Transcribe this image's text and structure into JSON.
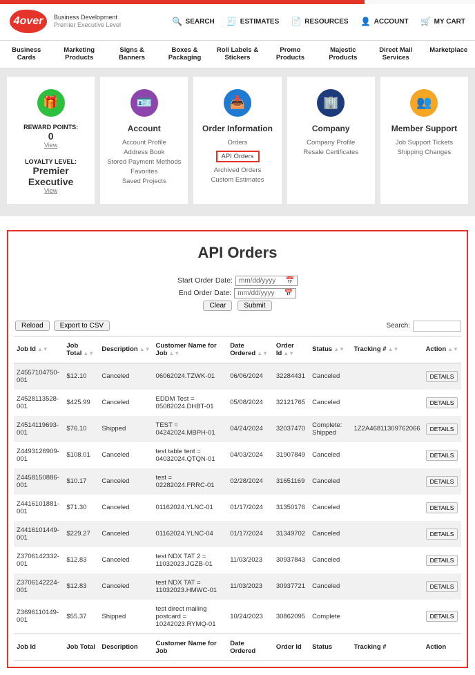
{
  "branding": {
    "logo_text": "4over",
    "sub1": "Business Development",
    "sub2": "Premier Executive Level"
  },
  "header_links": {
    "search": "SEARCH",
    "estimates": "ESTIMATES",
    "resources": "RESOURCES",
    "account": "ACCOUNT",
    "cart": "MY CART"
  },
  "nav": [
    "Business Cards",
    "Marketing Products",
    "Signs & Banners",
    "Boxes & Packaging",
    "Roll Labels & Stickers",
    "Promo Products",
    "Majestic Products",
    "Direct Mail Services",
    "Marketplace"
  ],
  "rewards": {
    "points_label": "REWARD POINTS:",
    "points_value": "0",
    "view": "View",
    "loyalty_label": "LOYALTY LEVEL:",
    "loyalty1": "Premier",
    "loyalty2": "Executive"
  },
  "cards": {
    "account": {
      "title": "Account",
      "links": [
        "Account Profile",
        "Address Book",
        "Stored Payment Methods",
        "Favorites",
        "Saved Projects"
      ]
    },
    "order_info": {
      "title": "Order Information",
      "links": [
        "Orders",
        "API Orders",
        "Archived Orders",
        "Custom Estimates"
      ],
      "selected_index": 1
    },
    "company": {
      "title": "Company",
      "links": [
        "Company Profile",
        "Resale Certificates"
      ]
    },
    "support": {
      "title": "Member Support",
      "links": [
        "Job Support Tickets",
        "Shipping Changes"
      ]
    }
  },
  "api_panel": {
    "title": "API Orders",
    "start_label": "Start Order Date:",
    "end_label": "End Order Date:",
    "date_placeholder": "mm/dd/yyyy",
    "clear": "Clear",
    "submit": "Submit",
    "reload": "Reload",
    "export": "Export to CSV",
    "search_label": "Search:"
  },
  "columns": [
    "Job Id",
    "Job Total",
    "Description",
    "Customer Name for Job",
    "Date Ordered",
    "Order Id",
    "Status",
    "Tracking #",
    "Action"
  ],
  "rows": [
    {
      "job": "Z4557104750-001",
      "total": "$12.10",
      "desc": "Canceled",
      "cust": "06062024.TZWK-01",
      "date": "06/06/2024",
      "order": "32284431",
      "status": "Canceled",
      "track": ""
    },
    {
      "job": "Z4528113528-001",
      "total": "$425.99",
      "desc": "Canceled",
      "cust": "EDDM Test = 05082024.DHBT-01",
      "date": "05/08/2024",
      "order": "32121765",
      "status": "Canceled",
      "track": ""
    },
    {
      "job": "Z4514119693-001",
      "total": "$76.10",
      "desc": "Shipped",
      "cust": "TEST = 04242024.MBPH-01",
      "date": "04/24/2024",
      "order": "32037470",
      "status": "Complete: Shipped",
      "track": "1Z2A46811309762066"
    },
    {
      "job": "Z4493126909-001",
      "total": "$108.01",
      "desc": "Canceled",
      "cust": "test table tent = 04032024.QTQN-01",
      "date": "04/03/2024",
      "order": "31907849",
      "status": "Canceled",
      "track": ""
    },
    {
      "job": "Z4458150886-001",
      "total": "$10.17",
      "desc": "Canceled",
      "cust": "test = 02282024.FRRC-01",
      "date": "02/28/2024",
      "order": "31651169",
      "status": "Canceled",
      "track": ""
    },
    {
      "job": "Z4416101881-001",
      "total": "$71.30",
      "desc": "Canceled",
      "cust": "01162024.YLNC-01",
      "date": "01/17/2024",
      "order": "31350176",
      "status": "Canceled",
      "track": ""
    },
    {
      "job": "Z4416101449-001",
      "total": "$229.27",
      "desc": "Canceled",
      "cust": "01162024.YLNC-04",
      "date": "01/17/2024",
      "order": "31349702",
      "status": "Canceled",
      "track": ""
    },
    {
      "job": "Z3706142332-001",
      "total": "$12.83",
      "desc": "Canceled",
      "cust": "test NDX TAT 2 = 11032023.JGZB-01",
      "date": "11/03/2023",
      "order": "30937843",
      "status": "Canceled",
      "track": ""
    },
    {
      "job": "Z3706142224-001",
      "total": "$12.83",
      "desc": "Canceled",
      "cust": "test NDX TAT = 11032023.HMWC-01",
      "date": "11/03/2023",
      "order": "30937721",
      "status": "Canceled",
      "track": ""
    },
    {
      "job": "Z3696110149-001",
      "total": "$55.37",
      "desc": "Shipped",
      "cust": "test direct mailing postcard = 10242023.RYMQ-01",
      "date": "10/24/2023",
      "order": "30862095",
      "status": "Complete",
      "track": ""
    }
  ],
  "details_label": "DETAILS"
}
